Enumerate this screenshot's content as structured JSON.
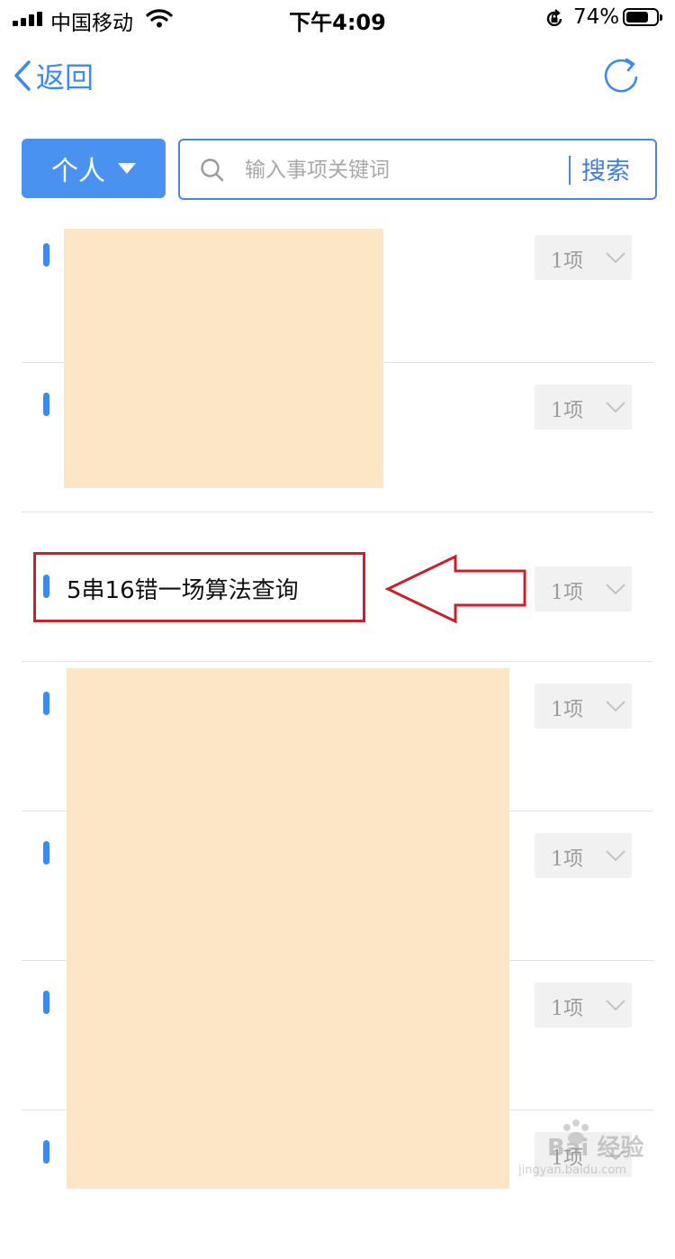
{
  "status_bar": {
    "carrier": "中国移动",
    "time": "下午4:09",
    "battery": "74%",
    "battery_level": 0.74
  },
  "nav": {
    "back_label": "返回",
    "back_icon": "chevron-left-icon",
    "refresh_icon": "refresh-icon"
  },
  "search": {
    "scope_label": "个人",
    "placeholder": "输入事项关键词",
    "value": "",
    "button_label": "搜索"
  },
  "list": {
    "rows": [
      {
        "title": "",
        "count": "1项"
      },
      {
        "title": "",
        "count": "1项"
      },
      {
        "title": "5串16错一场算法查询",
        "count": "1项"
      },
      {
        "title": "",
        "count": "1项"
      },
      {
        "title": "",
        "count": "1项"
      },
      {
        "title": "",
        "count": "1项"
      },
      {
        "title": "",
        "count": "1项"
      }
    ]
  },
  "watermark": {
    "text": "Bai 经验",
    "sub": "jingyan.baidu.com"
  },
  "colors": {
    "accent": "#4a92f0",
    "highlight": "#cc1f2b",
    "redaction": "#fce6c5"
  }
}
